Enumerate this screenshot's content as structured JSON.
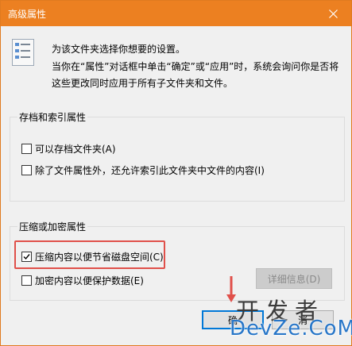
{
  "window": {
    "title": "高级属性"
  },
  "intro": {
    "line1": "为该文件夹选择你想要的设置。",
    "line2": "当你在“属性”对话框中单击“确定”或“应用”时，系统会询问你是否将这些更改同时应用于所有子文件夹和文件。"
  },
  "archive_group": {
    "legend": "存档和索引属性",
    "archive_label": "可以存档文件夹(A)",
    "archive_checked": false,
    "index_label": "除了文件属性外，还允许索引此文件夹中文件的内容(I)",
    "index_checked": false
  },
  "compress_group": {
    "legend": "压缩或加密属性",
    "compress_label": "压缩内容以便节省磁盘空间(C)",
    "compress_checked": true,
    "encrypt_label": "加密内容以便保护数据(E)",
    "encrypt_checked": false,
    "details_label": "详细信息(D)"
  },
  "buttons": {
    "ok_label": "确",
    "cancel_label": "消"
  },
  "watermark": {
    "top": "开发者",
    "bottom": "DevZe.CoM"
  },
  "colors": {
    "titlebar": "#ec8021",
    "highlight": "#e0504a",
    "ok_border": "#0078d7",
    "watermark_blue": "#2876c8"
  },
  "icons": {
    "close": "close-icon",
    "intro": "properties-list-icon",
    "check": "check-icon",
    "arrow": "arrow-down-icon"
  }
}
